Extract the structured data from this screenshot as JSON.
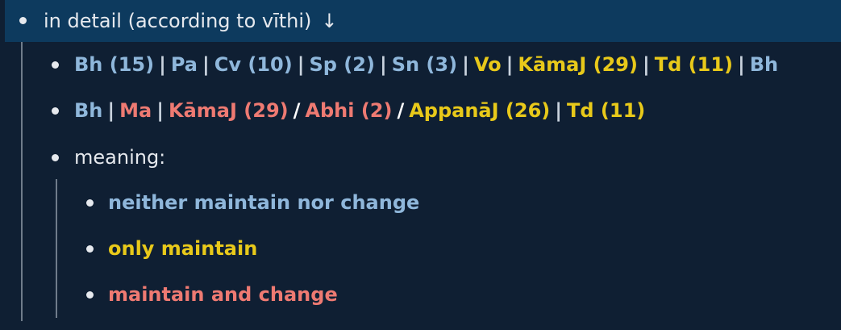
{
  "header": {
    "title": "in detail (according to vīthi)",
    "arrow": "↓"
  },
  "line1": [
    "Bh (15)",
    "Pa",
    "Cv (10)",
    "Sp (2)",
    "Sn (3)",
    "Vo",
    "KāmaJ (29)",
    "Td (11)",
    "Bh"
  ],
  "line2": [
    "Bh",
    "Ma",
    "KāmaJ (29)",
    "Abhi (2)",
    "AppanāJ (26)",
    "Td (11)"
  ],
  "meaning": {
    "label": "meaning:",
    "items": [
      "neither maintain nor change",
      "only maintain",
      "maintain and change"
    ]
  },
  "colors": {
    "blue": "#8fb7db",
    "yellow": "#e8c91a",
    "red": "#ee7a72",
    "header_bg": "#0d3a5e",
    "page_bg": "#0f1f33"
  }
}
